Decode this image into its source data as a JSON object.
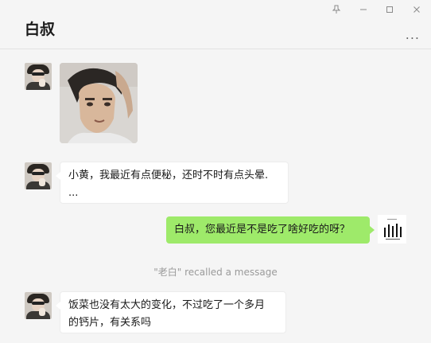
{
  "window": {
    "title": "白叔",
    "controls": [
      "pin-icon",
      "minimize-icon",
      "maximize-icon",
      "close-icon"
    ],
    "more_label": "..."
  },
  "messages": [
    {
      "side": "left",
      "type": "image"
    },
    {
      "side": "left",
      "type": "text",
      "text": "小黄，我最近有点便秘，还时不时有点头晕.\n..."
    },
    {
      "side": "right",
      "type": "text",
      "text": "白叔，您最近是不是吃了啥好吃的呀？"
    },
    {
      "side": "system",
      "type": "notice",
      "text": "\"老白\" recalled a message"
    },
    {
      "side": "left",
      "type": "text",
      "text": "饭菜也没有太大的变化，不过吃了一个多月\n的钙片，有关系吗"
    }
  ],
  "colors": {
    "background": "#f5f5f5",
    "bubble_self": "#9eea6a",
    "bubble_other": "#ffffff"
  }
}
